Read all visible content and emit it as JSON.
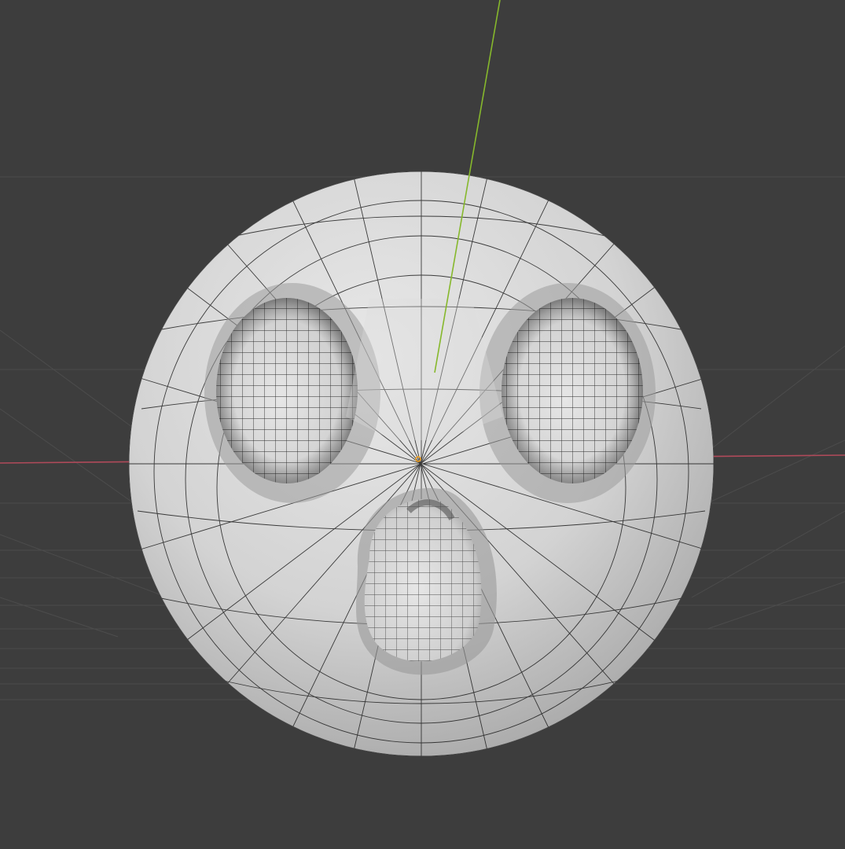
{
  "viewport": {
    "kind": "3D viewport",
    "view": "perspective",
    "shading": "solid",
    "overlay": "wireframe",
    "background_color": "#3d3d3d",
    "grid_color": "#4a4a4a",
    "x_axis_color": "#b04a5a",
    "y_axis_color": "#86b82c",
    "mesh_color": "#d2d2d2",
    "wire_color": "#1e1e1e",
    "origin_color": "#f0a020"
  },
  "object": {
    "type": "mesh",
    "shape": "sphere with two eye sockets and a mouth cavity",
    "selected": false
  }
}
